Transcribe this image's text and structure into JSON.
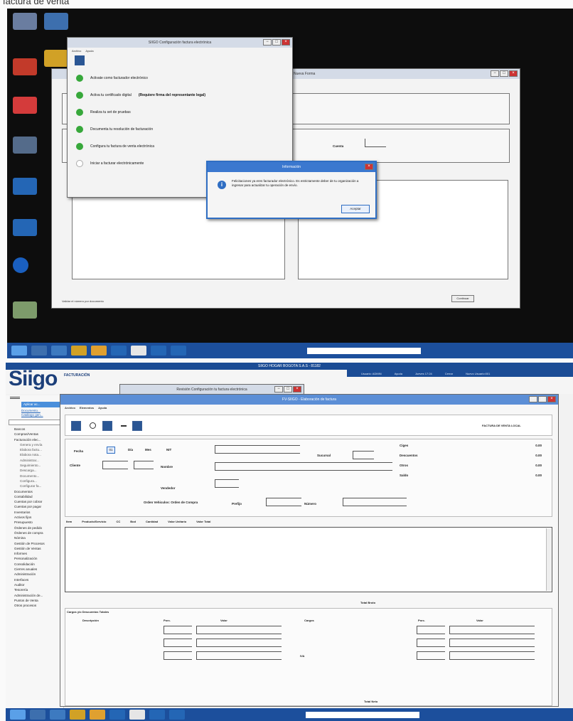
{
  "caption": "factura de venta",
  "screen1": {
    "config_window": {
      "title": "SIIGO Configuración factura electrónica",
      "menu": [
        "Archivo",
        "Ayuda"
      ],
      "steps": [
        {
          "label": "Activate como facturador electrónico",
          "done": true
        },
        {
          "label": "Activa tu certificado digital",
          "done": true,
          "note": "(Requiere firma del representante legal)"
        },
        {
          "label": "Realiza tu set de pruebas",
          "done": true
        },
        {
          "label": "Documenta tu resolución de facturación",
          "done": true
        },
        {
          "label": "Configura tu factura de venta electrónica",
          "done": true
        },
        {
          "label": "Iniciar a facturar electrónicamente",
          "done": false
        }
      ]
    },
    "back_window": {
      "title": "Nueva Forma",
      "field_label": "Cuenta"
    },
    "alert_dialog": {
      "title": "Información",
      "message": "Felicitaciones ya eres facturador electrónico. Es estrictamente deber de tu organización a ingresar para actualizar tu operación de envío.",
      "button": "Aceptar"
    },
    "bottom_label": "Validar el número por documento",
    "continue_button": "Continuar"
  },
  "screen2": {
    "top_title": "SIIGO HOGAR BOGOTA S.A.S - 81182",
    "logo": "Siigo",
    "logo_sub": "FACTURACIÓN",
    "header_info": [
      "Usuario: ADMIN",
      "Ayuda",
      "Jueves 17:24",
      "Cerrar",
      "Nuevo Usuario:001"
    ],
    "sidebar": {
      "buttons": [
        "Aplicar ac...",
        "Documento...",
        "Catálogo gen..."
      ],
      "items": [
        {
          "label": "Bancos",
          "sub": false
        },
        {
          "label": "Compras/Ventas",
          "sub": false
        },
        {
          "label": "Facturación elec...",
          "sub": false
        },
        {
          "label": "Genera y envía",
          "sub": true
        },
        {
          "label": "Elabora factu...",
          "sub": true
        },
        {
          "label": "Elabora nota...",
          "sub": true
        },
        {
          "label": "Administrar...",
          "sub": true
        },
        {
          "label": "Seguimiento...",
          "sub": true
        },
        {
          "label": "Descarga...",
          "sub": true
        },
        {
          "label": "Documento...",
          "sub": true
        },
        {
          "label": "Configura...",
          "sub": true
        },
        {
          "label": "Configurar fa...",
          "sub": true
        },
        {
          "label": "Documentos",
          "sub": false
        },
        {
          "label": "Contabilidad",
          "sub": false
        },
        {
          "label": "Cuentas por cobrar",
          "sub": false
        },
        {
          "label": "Cuentas por pagar",
          "sub": false
        },
        {
          "label": "Inventarios",
          "sub": false
        },
        {
          "label": "Activos fijos",
          "sub": false
        },
        {
          "label": "Presupuesto",
          "sub": false
        },
        {
          "label": "Órdenes de pedido",
          "sub": false
        },
        {
          "label": "Órdenes de compra",
          "sub": false
        },
        {
          "label": "Nómina",
          "sub": false
        },
        {
          "label": "Gestión de Procesos",
          "sub": false
        },
        {
          "label": "Gestión de Ventas",
          "sub": false
        },
        {
          "label": "Informes",
          "sub": false
        },
        {
          "label": "Personalización",
          "sub": false
        },
        {
          "label": "Consolidación",
          "sub": false
        },
        {
          "label": "Cierres anuales",
          "sub": false
        },
        {
          "label": "Administración",
          "sub": false
        },
        {
          "label": "Interfaces",
          "sub": false
        },
        {
          "label": "Auditor",
          "sub": false
        },
        {
          "label": "Tesorería",
          "sub": false
        },
        {
          "label": "Administración de...",
          "sub": false
        },
        {
          "label": "Puntos de Venta",
          "sub": false
        },
        {
          "label": "Otros procesos",
          "sub": false
        }
      ]
    },
    "form_window": {
      "title": "FV-SIIGO - Elaboración de factura",
      "behind_title": "Revisión Configuración tu factura electrónica",
      "menu": [
        "Archivo",
        "Elementos",
        "Ayuda"
      ],
      "doc_type": "FACTURA DE VENTA LOCAL",
      "labels": {
        "fecha": "Fecha",
        "dia": "Día",
        "mes": "Mes",
        "anio": "Año",
        "nit": "NIT",
        "sucursal": "Sucursal",
        "cliente": "Cliente",
        "nombre": "Nombre",
        "vendedor": "Vendedor",
        "orden": "Orden Vehiculos: Orden de Compra",
        "prefijo": "Prefijo",
        "numero": "Número"
      },
      "fecha_value": "01",
      "totals": [
        {
          "label": "Ciges",
          "value": "0.00"
        },
        {
          "label": "Descuentos",
          "value": "0.00"
        },
        {
          "label": "Otros",
          "value": "0.00"
        },
        {
          "label": "Saldo",
          "value": "0.00"
        }
      ],
      "table_headers": [
        "Item",
        "Producto/Servicio",
        "CC",
        "Bod",
        "Cantidad",
        "Valor Unitario",
        "Valor Total"
      ],
      "total_bruto": "Total Bruto",
      "section_title": "Cargos y/o Descuentos Totales",
      "col_headers": [
        "Descripción",
        "Porc.",
        "Valor",
        "Cargos",
        "Porc.",
        "Valor"
      ],
      "iva": "IVA",
      "total_neto": "Total Neto"
    }
  }
}
